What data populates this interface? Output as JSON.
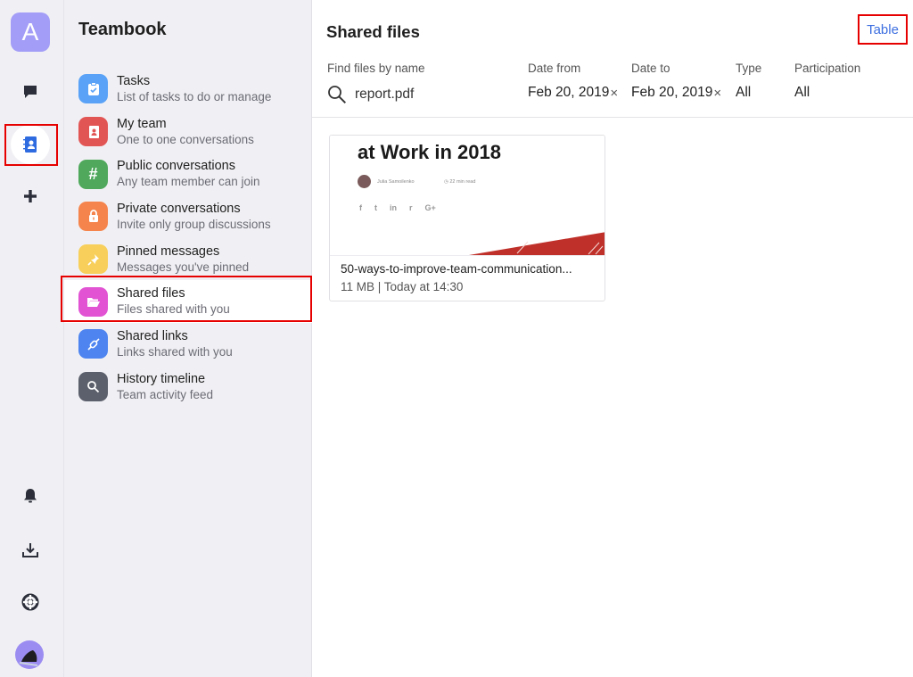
{
  "rail": {
    "app_initial": "A",
    "items": [
      {
        "name": "chat-icon",
        "active": false
      },
      {
        "name": "contacts-icon",
        "active": true
      },
      {
        "name": "add-icon",
        "active": false
      }
    ],
    "bottom_items": [
      "bell-icon",
      "download-icon",
      "help-icon",
      "user-avatar"
    ]
  },
  "nav": {
    "title": "Teambook",
    "items": [
      {
        "label": "Tasks",
        "sub": "List of tasks to do or manage",
        "icon": "clipboard-icon",
        "color": "#5aa2f7"
      },
      {
        "label": "My team",
        "sub": "One to one conversations",
        "icon": "contacts-book-icon",
        "color": "#e25555"
      },
      {
        "label": "Public conversations",
        "sub": "Any team member can join",
        "icon": "hash-icon",
        "color": "#4fa85c"
      },
      {
        "label": "Private conversations",
        "sub": "Invite only group discussions",
        "icon": "lock-icon",
        "color": "#f5844c"
      },
      {
        "label": "Pinned messages",
        "sub": "Messages you've pinned",
        "icon": "pin-icon",
        "color": "#f7cf5a"
      },
      {
        "label": "Shared files",
        "sub": "Files shared with you",
        "icon": "folder-icon",
        "color": "#e153d3",
        "active": true
      },
      {
        "label": "Shared links",
        "sub": "Links shared with you",
        "icon": "link-icon",
        "color": "#4d84f0"
      },
      {
        "label": "History timeline",
        "sub": "Team activity feed",
        "icon": "search-icon",
        "color": "#5c606c"
      }
    ]
  },
  "main": {
    "title": "Shared files",
    "view_toggle": "Table",
    "filters": {
      "search": {
        "label": "Find files by name",
        "value": "report.pdf"
      },
      "date_from": {
        "label": "Date from",
        "value": "Feb 20, 2019"
      },
      "date_to": {
        "label": "Date to",
        "value": "Feb 20, 2019"
      },
      "type": {
        "label": "Type",
        "value": "All"
      },
      "participation": {
        "label": "Participation",
        "value": "All"
      },
      "clear_glyph": "×"
    },
    "files": [
      {
        "name": "50-ways-to-improve-team-communication...",
        "meta": "11 MB | Today at 14:30",
        "preview": {
          "title": "at Work in 2018",
          "author": "Julia Samoilenko",
          "read_time": "22 min read",
          "social": [
            "f",
            "t",
            "in",
            "r",
            "G+"
          ]
        }
      }
    ]
  },
  "colors": {
    "accent": "#3d6fe0",
    "highlight": "#e60000",
    "app_avatar": "#a39df7"
  }
}
